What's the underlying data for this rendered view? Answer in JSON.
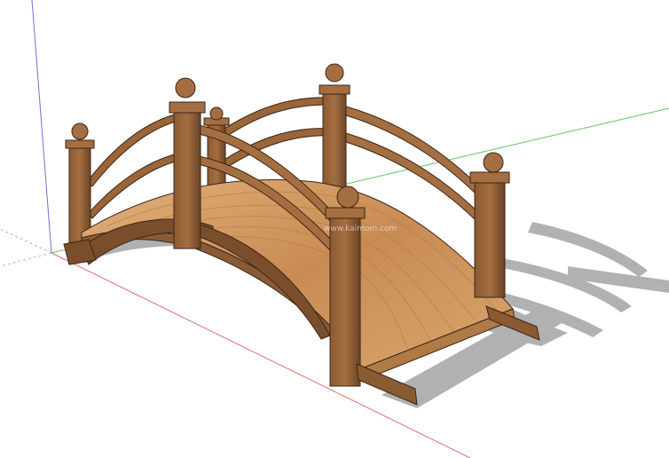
{
  "viewport": {
    "background": "#ffffff",
    "axes": {
      "blue_axis_color": "#6f6fd8",
      "red_axis_color": "#e07070",
      "green_axis_color": "#66c266"
    }
  },
  "model": {
    "subject": "wooden-arched-garden-bridge",
    "wood_light": "#d9a66e",
    "wood_mid": "#b07a47",
    "wood_dark": "#7a4e2c",
    "edge": "#3a2616",
    "shadow": "#a9a9a9"
  },
  "watermark": {
    "text": "www.kaimom.com"
  }
}
